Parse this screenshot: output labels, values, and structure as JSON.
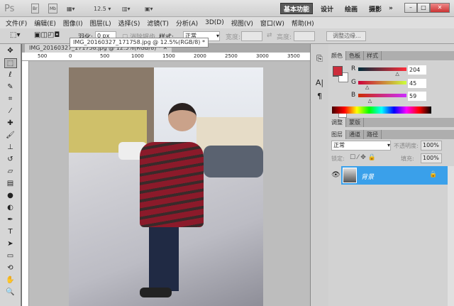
{
  "appbar": {
    "logo": "Ps",
    "br": "Br",
    "mb": "Mb",
    "zoom": "12.5",
    "workspaces": [
      "基本功能",
      "设计",
      "绘画",
      "摄影"
    ],
    "more": "»"
  },
  "menu": [
    "文件(F)",
    "编辑(E)",
    "图像(I)",
    "图层(L)",
    "选择(S)",
    "滤镜(T)",
    "分析(A)",
    "3D(D)",
    "视图(V)",
    "窗口(W)",
    "帮助(H)"
  ],
  "options": {
    "feather_label": "羽化:",
    "feather_value": "0 px",
    "antialias": "消除锯齿",
    "style_label": "样式:",
    "style_value": "正常",
    "width_label": "宽度:",
    "height_label": "高度:",
    "refine_edge": "调整边缘..."
  },
  "document": {
    "tab_title": "IMG_20160327_171758.jpg @ 12.5%(RGB/8) *",
    "tooltip": "IMG_20160327_171758.jpg @ 12.5%(RGB/8) *",
    "ruler_ticks": [
      "500",
      "0",
      "500",
      "1000",
      "1500",
      "2000",
      "2500",
      "3000",
      "3500"
    ]
  },
  "color_panel": {
    "tabs": [
      "颜色",
      "色板",
      "样式"
    ],
    "r_label": "R",
    "g_label": "G",
    "b_label": "B",
    "r": 204,
    "g": 45,
    "b": 59,
    "foreground": "#cc2d3b",
    "background": "#ffffff"
  },
  "adjust_panel": {
    "tabs": [
      "调整",
      "蒙版"
    ]
  },
  "layers_panel": {
    "tabs": [
      "图层",
      "通道",
      "路径"
    ],
    "blend_mode": "正常",
    "opacity_label": "不透明度:",
    "opacity": "100%",
    "lock_label": "锁定:",
    "fill_label": "填充:",
    "fill": "100%",
    "layers": [
      {
        "name": "背景",
        "selected": true,
        "locked": true
      }
    ]
  },
  "accent": "#3aa0ea"
}
